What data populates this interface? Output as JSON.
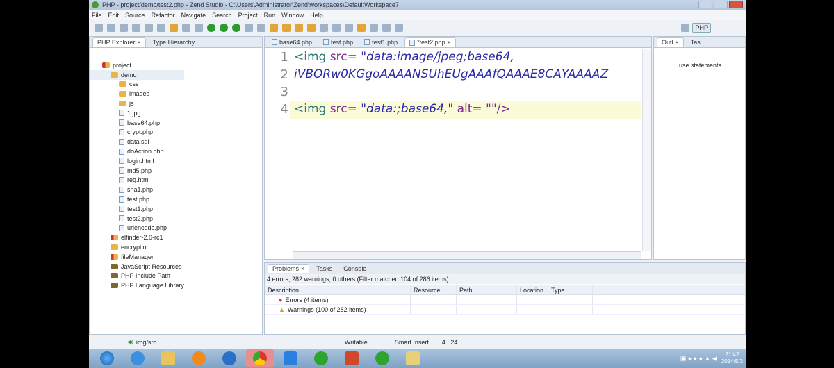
{
  "window": {
    "title": "PHP - project/demo/test2.php - Zend Studio - C:\\Users\\Administrator\\Zend\\workspaces\\DefaultWorkspace7"
  },
  "menu": [
    "File",
    "Edit",
    "Source",
    "Refactor",
    "Navigate",
    "Search",
    "Project",
    "Run",
    "Window",
    "Help"
  ],
  "perspective": "PHP",
  "left_panel": {
    "tabs": [
      "PHP Explorer",
      "Type Hierarchy"
    ],
    "tree": [
      {
        "label": "project",
        "depth": 0,
        "icon": "project"
      },
      {
        "label": "demo",
        "depth": 1,
        "icon": "folder"
      },
      {
        "label": "css",
        "depth": 2,
        "icon": "folder"
      },
      {
        "label": "images",
        "depth": 2,
        "icon": "folder"
      },
      {
        "label": "js",
        "depth": 2,
        "icon": "folder"
      },
      {
        "label": "1.jpg",
        "depth": 2,
        "icon": "image"
      },
      {
        "label": "base64.php",
        "depth": 2,
        "icon": "file"
      },
      {
        "label": "crypt.php",
        "depth": 2,
        "icon": "file"
      },
      {
        "label": "data.sql",
        "depth": 2,
        "icon": "file"
      },
      {
        "label": "doAction.php",
        "depth": 2,
        "icon": "file"
      },
      {
        "label": "login.html",
        "depth": 2,
        "icon": "file"
      },
      {
        "label": "md5.php",
        "depth": 2,
        "icon": "file"
      },
      {
        "label": "reg.html",
        "depth": 2,
        "icon": "file"
      },
      {
        "label": "sha1.php",
        "depth": 2,
        "icon": "file"
      },
      {
        "label": "test.php",
        "depth": 2,
        "icon": "file"
      },
      {
        "label": "test1.php",
        "depth": 2,
        "icon": "file"
      },
      {
        "label": "test2.php",
        "depth": 2,
        "icon": "file"
      },
      {
        "label": "urlencode.php",
        "depth": 2,
        "icon": "file"
      },
      {
        "label": "elfinder-2.0-rc1",
        "depth": 1,
        "icon": "project"
      },
      {
        "label": "encryption",
        "depth": 1,
        "icon": "folder"
      },
      {
        "label": "fileManager",
        "depth": 1,
        "icon": "project"
      },
      {
        "label": "JavaScript Resources",
        "depth": 1,
        "icon": "library"
      },
      {
        "label": "PHP Include Path",
        "depth": 1,
        "icon": "library"
      },
      {
        "label": "PHP Language Library",
        "depth": 1,
        "icon": "library"
      }
    ]
  },
  "editor": {
    "tabs": [
      "base64.php",
      "test.php",
      "test1.php",
      "*test2.php"
    ],
    "lines": [
      {
        "num": "1",
        "tag": "<img ",
        "attr": "src",
        "eq": "= ",
        "str": "\"data:image/jpeg;base64,",
        "rest": ""
      },
      {
        "num": "2",
        "tag": "",
        "attr": "",
        "eq": "",
        "str": "iVBORw0KGgoAAAANSUhEUgAAAfQAAAE8CAYAAAAZ",
        "rest": ""
      },
      {
        "num": "3",
        "tag": "",
        "attr": "",
        "eq": "",
        "str": "",
        "rest": ""
      },
      {
        "num": "4",
        "tag": "<img ",
        "attr": "src",
        "eq": "= ",
        "str": "\"data:;base64,\"",
        "rest": " alt= \"\"/>"
      }
    ]
  },
  "outline": {
    "tabs": [
      "Outl",
      "Tas"
    ],
    "items": [
      "use statements"
    ]
  },
  "problems": {
    "tabs": [
      "Problems",
      "Tasks",
      "Console"
    ],
    "summary": "4 errors, 282 warnings, 0 others (Filter matched 104 of 286 items)",
    "columns": [
      "Description",
      "Resource",
      "Path",
      "Location",
      "Type"
    ],
    "rows": [
      "Errors (4 items)",
      "Warnings (100 of 282 items)"
    ]
  },
  "status": {
    "element": "img/src",
    "writable": "Writable",
    "mode": "Smart Insert",
    "position": "4 : 24"
  },
  "clock": {
    "time": "21:42",
    "date": "2014/5/3"
  }
}
